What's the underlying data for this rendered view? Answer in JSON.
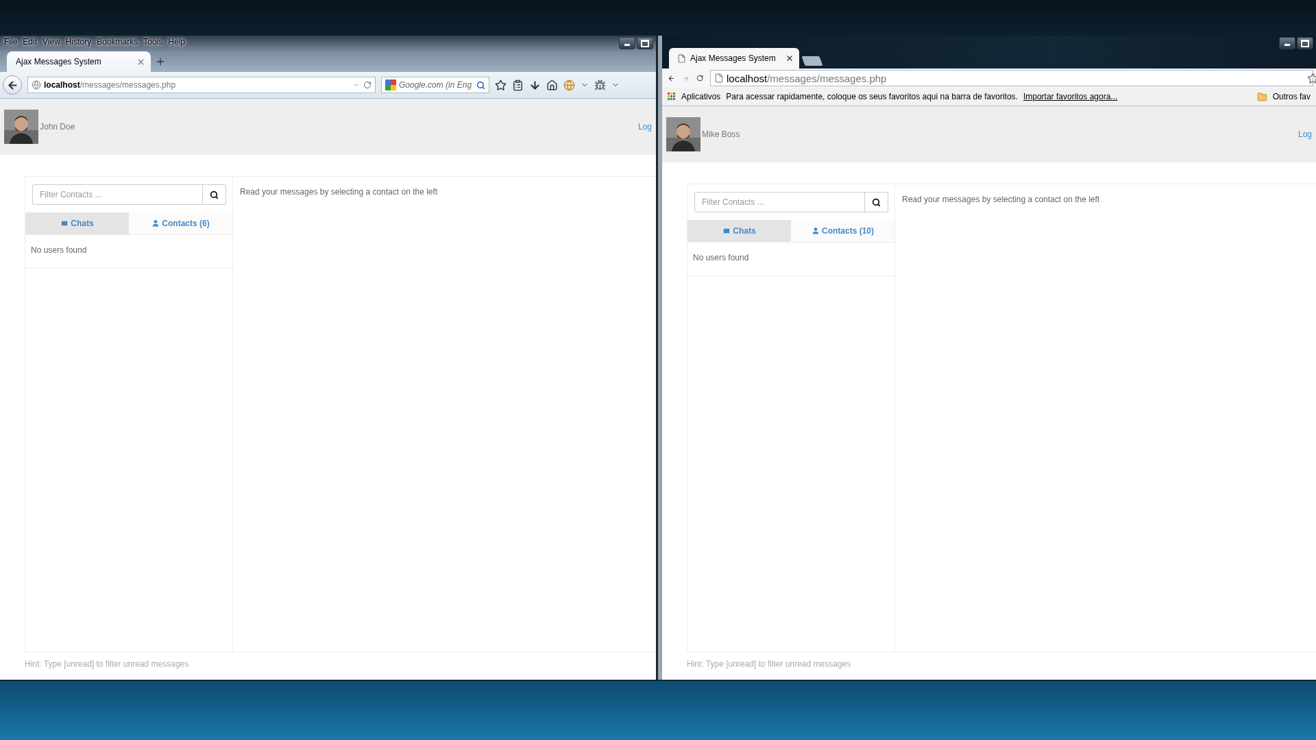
{
  "windows": [
    {
      "kind": "firefox",
      "menu": [
        "File",
        "Edit",
        "View",
        "History",
        "Bookmarks",
        "Tools",
        "Help"
      ],
      "tabs": [
        {
          "label": "Ajax Messages System",
          "selected": true
        }
      ],
      "url_host": "localhost",
      "url_path": "/messages/messages.php",
      "search_placeholder": "Google.com (in Eng",
      "page": {
        "user_name": "John Doe",
        "logout": "Log",
        "filter_placeholder": "Filter Contacts ...",
        "list_tabs": [
          {
            "label": "Chats",
            "selected": true
          },
          {
            "label": "Contacts (6)",
            "selected": false
          }
        ],
        "empty_text": "No users found",
        "main_text": "Read your messages by selecting a contact on the left",
        "hint": "Hint: Type [unread] to filter unread messages"
      }
    },
    {
      "kind": "chrome",
      "tabs": [
        {
          "label": "Ajax Messages System",
          "selected": true
        }
      ],
      "forward_disabled": true,
      "url_host": "localhost",
      "url_path": "/messages/messages.php",
      "bookmarks": {
        "apps": "Aplicativos",
        "message": "Para acessar rapidamente, coloque os seus favoritos aqui na barra de favoritos.",
        "link": "Importar favoritos agora...",
        "folder": "Outros fav"
      },
      "page": {
        "user_name": "Mike Boss",
        "logout": "Log",
        "filter_placeholder": "Filter Contacts ...",
        "list_tabs": [
          {
            "label": "Chats",
            "selected": true
          },
          {
            "label": "Contacts (10)",
            "selected": false
          }
        ],
        "empty_text": "No users found",
        "main_text": "Read your messages by selecting a contact on the left",
        "hint": "Hint: Type [unread] to filter unread messages"
      }
    }
  ]
}
